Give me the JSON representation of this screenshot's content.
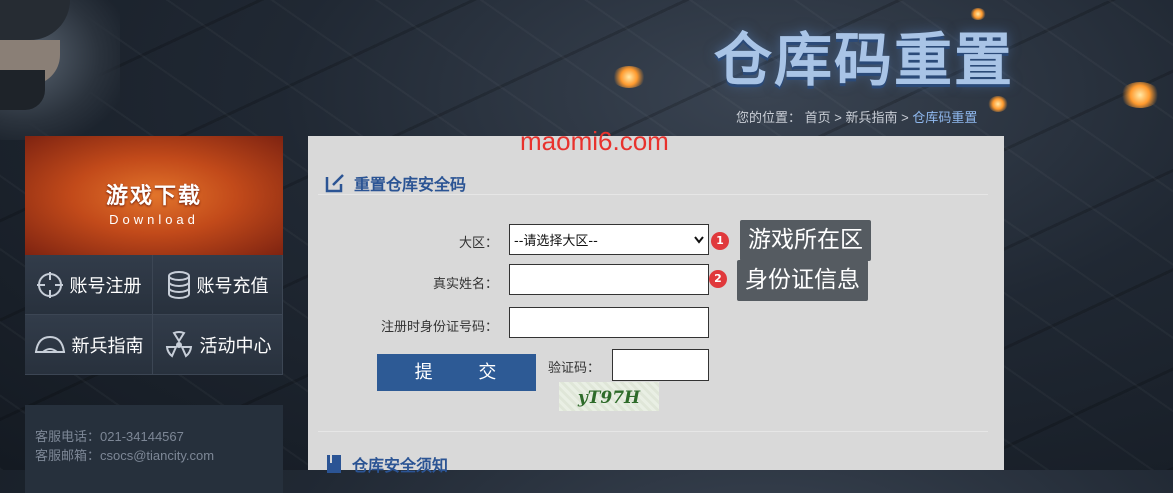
{
  "header": {
    "title": "仓库码重置",
    "breadcrumb": {
      "prefix": "您的位置：",
      "home": "首页",
      "sep1": " > ",
      "guide": "新兵指南",
      "sep2": " > ",
      "current": "仓库码重置"
    }
  },
  "sidebar": {
    "download": {
      "title": "游戏下载",
      "subtitle": "Download"
    },
    "menu": [
      {
        "label": "账号注册",
        "icon": "crosshair-icon"
      },
      {
        "label": "账号充值",
        "icon": "coin-stack-icon"
      },
      {
        "label": "新兵指南",
        "icon": "helmet-icon"
      },
      {
        "label": "活动中心",
        "icon": "radiation-icon"
      }
    ],
    "contact": {
      "phone": "客服电话：021-34144567",
      "email": "客服邮箱：csocs@tiancity.com"
    }
  },
  "watermark": "maomi6.com",
  "form": {
    "section_title": "重置仓库安全码",
    "region_label": "大区：",
    "region_value": "--请选择大区--",
    "name_label": "真实姓名：",
    "name_value": "",
    "idcard_label": "注册时身份证号码：",
    "idcard_value": "",
    "captcha_label": "验证码：",
    "captcha_value": "",
    "captcha_image_text": "yT97H",
    "submit_label": "提 交"
  },
  "annotations": [
    {
      "number": "1",
      "text": "游戏所在区"
    },
    {
      "number": "2",
      "text": "身份证信息"
    }
  ],
  "section2_title": "仓库安全须知",
  "colors": {
    "accent_blue": "#2d5a95",
    "badge_red": "#e0393c",
    "download_orange": "#c24a1a"
  }
}
